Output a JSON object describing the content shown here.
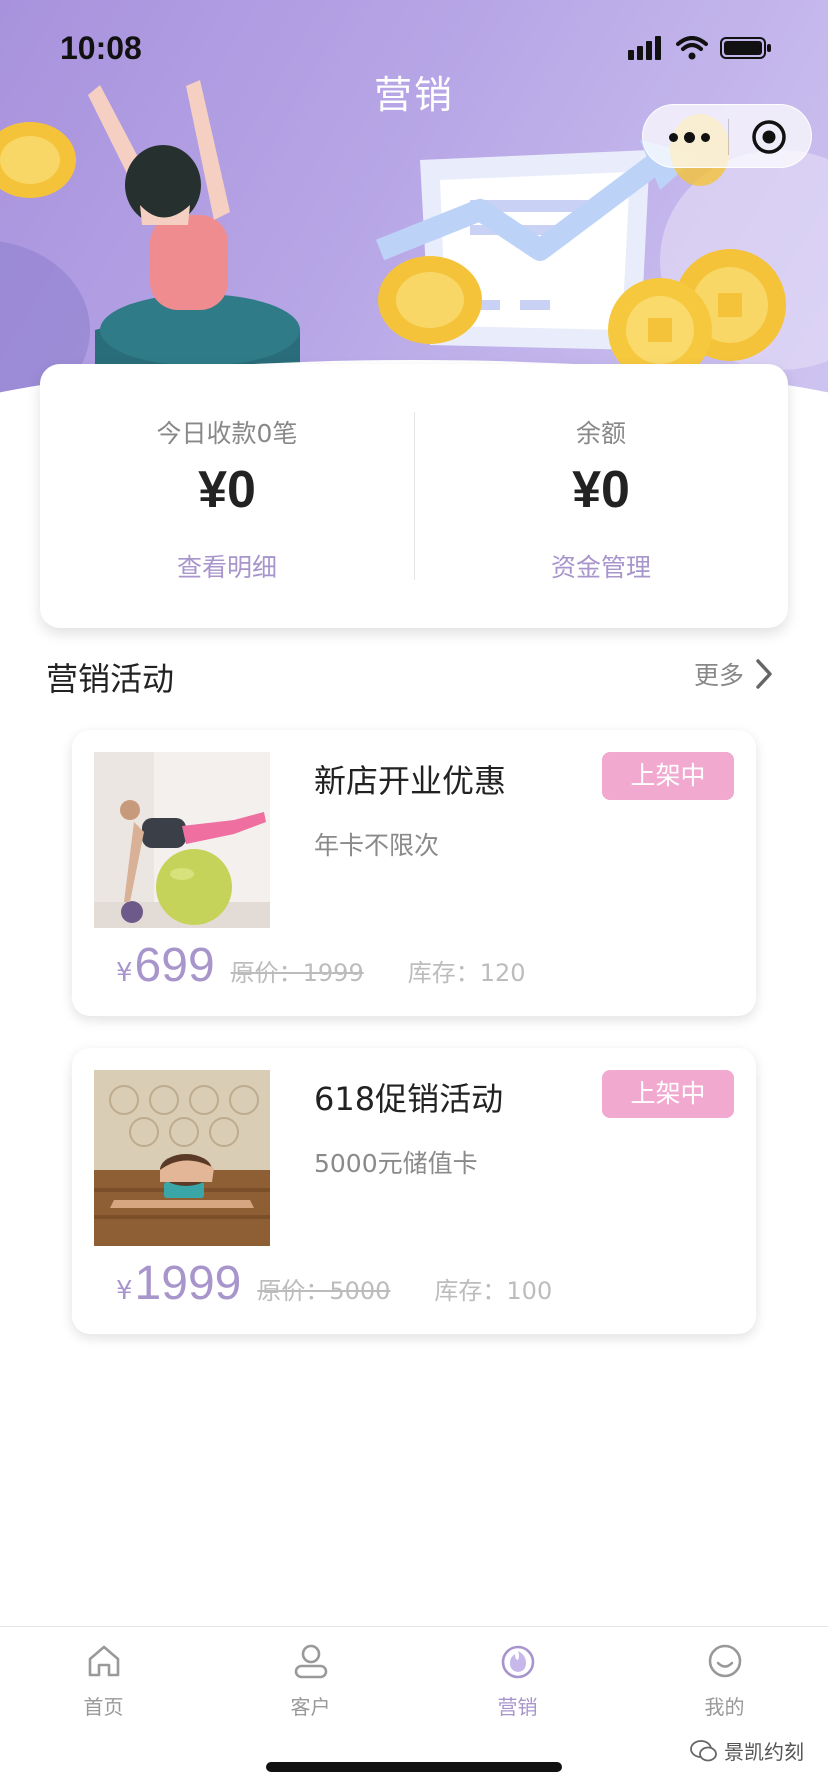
{
  "status_bar": {
    "time": "10:08"
  },
  "nav": {
    "title": "营销"
  },
  "summary": {
    "left": {
      "label": "今日收款0笔",
      "amount": "¥0",
      "link": "查看明细"
    },
    "right": {
      "label": "余额",
      "amount": "¥0",
      "link": "资金管理"
    }
  },
  "section": {
    "title": "营销活动",
    "more_label": "更多"
  },
  "activities": [
    {
      "name": "新店开业优惠",
      "desc": "年卡不限次",
      "badge": "上架中",
      "currency": "¥",
      "price": "699",
      "original_price": "原价：1999",
      "stock": "库存：120"
    },
    {
      "name": "618促销活动",
      "desc": "5000元储值卡",
      "badge": "上架中",
      "currency": "¥",
      "price": "1999",
      "original_price": "原价：5000",
      "stock": "库存：100"
    }
  ],
  "tabbar": {
    "items": [
      {
        "label": "首页",
        "icon": "home-icon",
        "active": false
      },
      {
        "label": "客户",
        "icon": "user-icon",
        "active": false
      },
      {
        "label": "营销",
        "icon": "marketing-icon",
        "active": true
      },
      {
        "label": "我的",
        "icon": "smile-icon",
        "active": false
      }
    ]
  },
  "watermark": {
    "text": "景凯约刻"
  },
  "colors": {
    "accent": "#a795cc",
    "badge": "#f1a9cf",
    "hero_start": "#a892dd",
    "hero_end": "#cfc5f1"
  }
}
